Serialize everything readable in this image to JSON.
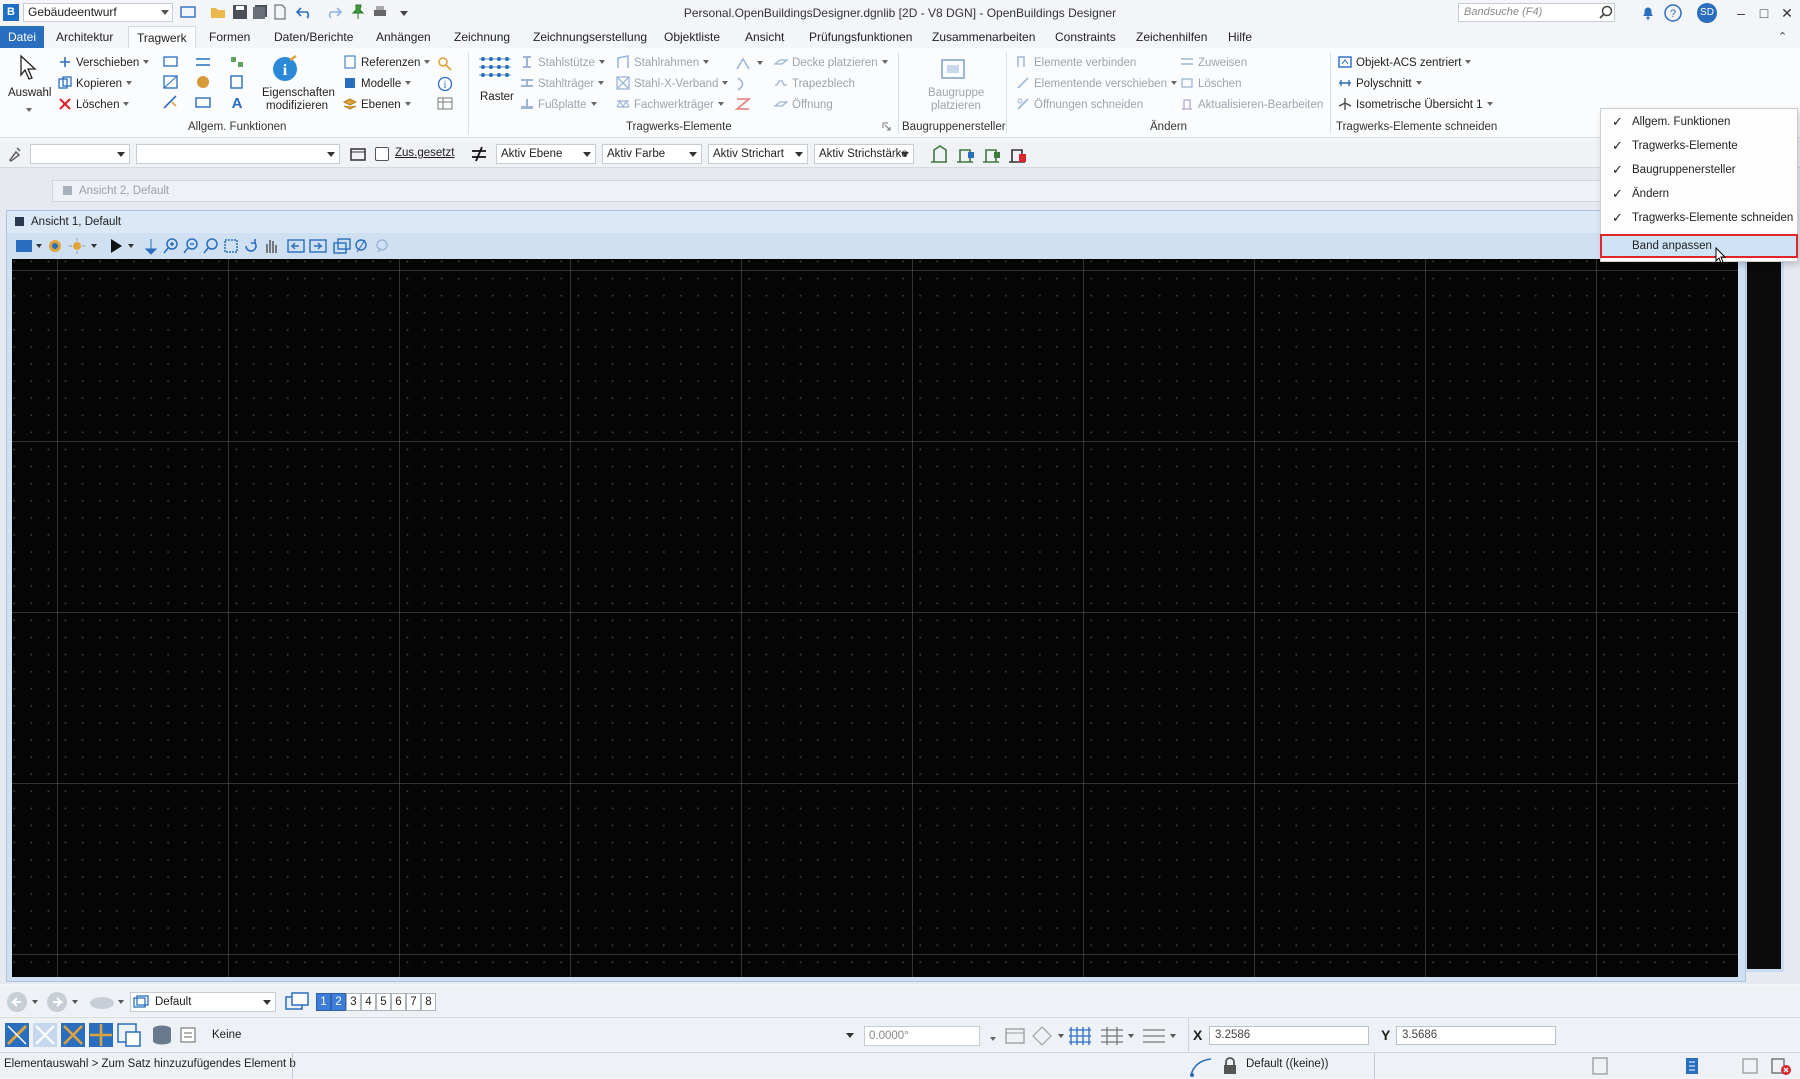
{
  "titlebar": {
    "app_icon_label": "B",
    "workflow": "Gebäudeentwurf",
    "window_title": "Personal.OpenBuildingsDesigner.dgnlib [2D - V8 DGN] - OpenBuildings Designer",
    "search_placeholder": "Bandsuche (F4)",
    "user_initials": "SD"
  },
  "menu_tabs": [
    "Datei",
    "Architektur",
    "Tragwerk",
    "Formen",
    "Daten/Berichte",
    "Anhängen",
    "Zeichnung",
    "Zeichnungserstellung",
    "Objektliste",
    "Ansicht",
    "Prüfungsfunktionen",
    "Zusammenarbeiten",
    "Constraints",
    "Zeichenhilfen",
    "Hilfe"
  ],
  "ribbon": {
    "auswahl": "Auswahl",
    "verschieben": "Verschieben",
    "kopieren": "Kopieren",
    "loeschen": "Löschen",
    "eigenschaften": "Eigenschaften",
    "modifizieren": "modifizieren",
    "referenzen": "Referenzen",
    "modelle": "Modelle",
    "ebenen": "Ebenen",
    "raster": "Raster",
    "stahlstuetze": "Stahlstütze",
    "stahltraeger": "Stahlträger",
    "fussplatte": "Fußplatte",
    "stahlrahmen": "Stahlrahmen",
    "stahl_x_verband": "Stahl-X-Verband",
    "fachwerktraeger": "Fachwerkträger",
    "decke_platzieren": "Decke platzieren",
    "trapezblech": "Trapezblech",
    "oeffnung": "Öffnung",
    "baugruppe": "Baugruppe",
    "platzieren": "platzieren",
    "elemente_verbinden": "Elemente verbinden",
    "elementende_verschieben": "Elementende verschieben",
    "oeffnungen_schneiden": "Öffnungen schneiden",
    "zuweisen": "Zuweisen",
    "loeschen2": "Löschen",
    "aktualisieren": "Aktualisieren-Bearbeiten",
    "objekt_acs": "Objekt-ACS zentriert",
    "polyschnitt": "Polyschnitt",
    "isometrische": "Isometrische Übersicht 1",
    "groups": {
      "allgem": "Allgem. Funktionen",
      "tragwerk": "Tragwerks-Elemente",
      "baugruppen": "Baugruppenersteller",
      "aendern": "Ändern",
      "schneiden": "Tragwerks-Elemente schneiden"
    }
  },
  "attrbar": {
    "zusgesetzt": "Zus.gesetzt",
    "aktiv_ebene": "Aktiv Ebene",
    "aktiv_farbe": "Aktiv Farbe",
    "aktiv_strichart": "Aktiv Strichart",
    "aktiv_strichstaerke": "Aktiv Strichstärke"
  },
  "views": {
    "view2_title": "Ansicht 2, Default",
    "view1_title": "Ansicht 1, Default"
  },
  "context_menu": [
    {
      "label": "Allgem. Funktionen",
      "checked": true
    },
    {
      "label": "Tragwerks-Elemente",
      "checked": true
    },
    {
      "label": "Baugruppenersteller",
      "checked": true
    },
    {
      "label": "Ändern",
      "checked": true
    },
    {
      "label": "Tragwerks-Elemente schneiden",
      "checked": true
    },
    {
      "label": "Band anpassen",
      "checked": false,
      "highlighted": true
    }
  ],
  "viewbar": {
    "view_group": "Default",
    "view_numbers": [
      "1",
      "2",
      "3",
      "4",
      "5",
      "6",
      "7",
      "8"
    ],
    "active_views": [
      "1",
      "2"
    ]
  },
  "snapbar": {
    "level": "Keine",
    "angle": "0.0000°",
    "x_label": "X",
    "x_value": "3.2586",
    "y_label": "Y",
    "y_value": "3.5686"
  },
  "statusbar": {
    "prompt": "Elementauswahl > Zum Satz hinzuzufügendes Element b",
    "model": "Default ((keine))"
  },
  "colors": {
    "accent": "#2a6ebf",
    "highlight_outline": "#e0252b",
    "canvas_bg": "#050505"
  }
}
